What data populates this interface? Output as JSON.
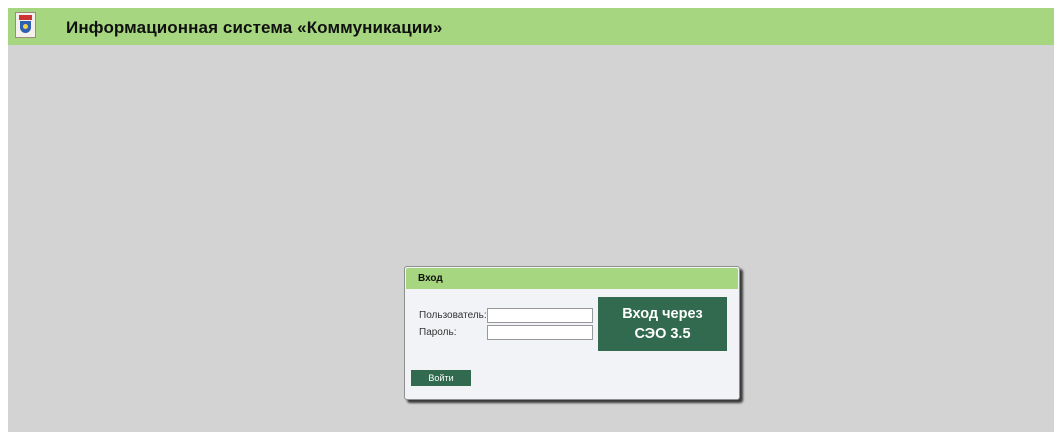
{
  "header": {
    "title": "Информационная система «Коммуникации»",
    "logo_icon": "coat-of-arms-icon",
    "background_color": "#a6d67f"
  },
  "page": {
    "background_color": "#d3d3d3"
  },
  "login": {
    "title": "Вход",
    "username_label": "Пользователь:",
    "username_value": "",
    "password_label": "Пароль:",
    "password_value": "",
    "sso_button_line1": "Вход через",
    "sso_button_line2": "СЭО 3.5",
    "submit_label": "Войти",
    "button_color": "#316a4e"
  }
}
